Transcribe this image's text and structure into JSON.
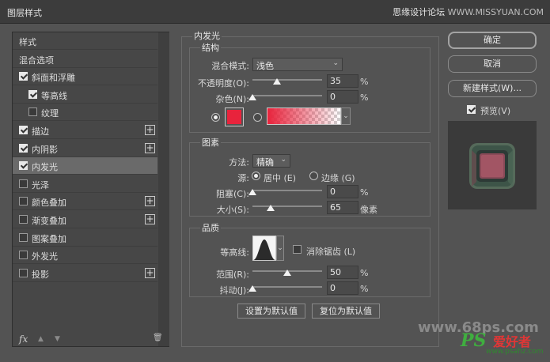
{
  "window": {
    "title": "图层样式",
    "watermark_1": "思缘设计论坛",
    "watermark_2": "WWW.MISSYUAN.COM"
  },
  "left_panel": {
    "items": [
      {
        "label": "样式",
        "checkbox": null,
        "plus": false
      },
      {
        "label": "混合选项",
        "checkbox": null,
        "plus": false
      },
      {
        "label": "斜面和浮雕",
        "checkbox": true,
        "plus": false
      },
      {
        "label": "等高线",
        "checkbox": true,
        "plus": false
      },
      {
        "label": "纹理",
        "checkbox": false,
        "plus": false
      },
      {
        "label": "描边",
        "checkbox": true,
        "plus": true
      },
      {
        "label": "内阴影",
        "checkbox": true,
        "plus": true
      },
      {
        "label": "内发光",
        "checkbox": true,
        "plus": false
      },
      {
        "label": "光泽",
        "checkbox": false,
        "plus": false
      },
      {
        "label": "颜色叠加",
        "checkbox": false,
        "plus": true
      },
      {
        "label": "渐变叠加",
        "checkbox": false,
        "plus": true
      },
      {
        "label": "图案叠加",
        "checkbox": false,
        "plus": false
      },
      {
        "label": "外发光",
        "checkbox": false,
        "plus": false
      },
      {
        "label": "投影",
        "checkbox": false,
        "plus": true
      }
    ],
    "fx_label": "fx",
    "up_icon": "▲",
    "down_icon": "▼",
    "trash_icon": "🗑"
  },
  "inner_glow": {
    "title": "内发光",
    "structure": {
      "title": "结构",
      "blend_mode_label": "混合模式:",
      "blend_mode_value": "浅色",
      "opacity_label": "不透明度(O):",
      "opacity_value": "35",
      "opacity_level": 35,
      "noise_label": "杂色(N):",
      "noise_value": "0",
      "noise_level": 0,
      "percent": "%",
      "glow_color": "#e8233c"
    },
    "elements": {
      "title": "图素",
      "method_label": "方法:",
      "method_value": "精确",
      "source_label": "源:",
      "source_center": "居中 (E)",
      "source_edge": "边缘 (G)",
      "choke_label": "阻塞(C):",
      "choke_value": "0",
      "choke_level": 0,
      "size_label": "大小(S):",
      "size_value": "65",
      "size_level": 26,
      "size_unit": "像素"
    },
    "quality": {
      "title": "品质",
      "contour_label": "等高线:",
      "antialias_label": "消除锯齿 (L)",
      "range_label": "范围(R):",
      "range_value": "50",
      "range_level": 50,
      "jitter_label": "抖动(J):",
      "jitter_value": "0",
      "jitter_level": 0
    },
    "set_default": "设置为默认值",
    "reset_default": "复位为默认值"
  },
  "right": {
    "ok": "确定",
    "cancel": "取消",
    "new_style": "新建样式(W)...",
    "preview_label": "预览(V)",
    "preview_checked": true
  },
  "footer_watermark_1": "www.68ps.com",
  "footer_watermark_2": "PS",
  "footer_watermark_3": "爱好者",
  "footer_watermark_4": "www.psahz.com"
}
